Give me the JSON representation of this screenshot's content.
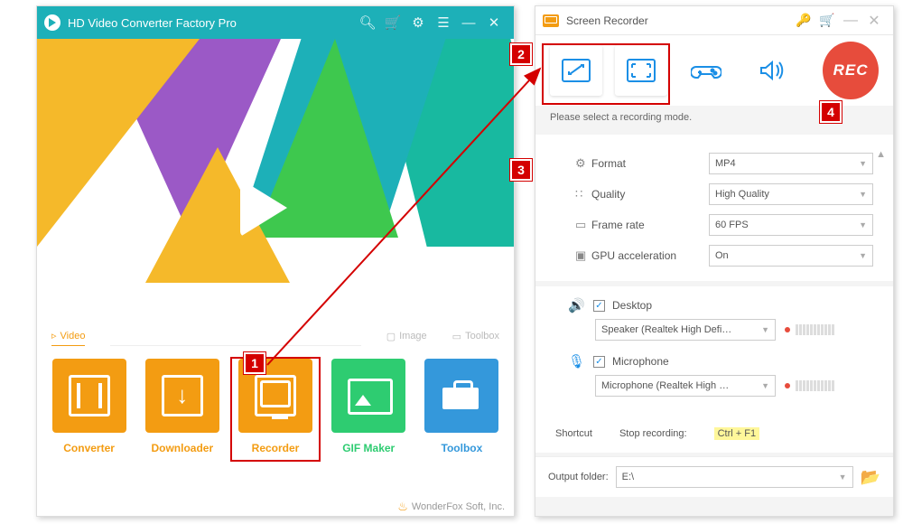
{
  "main": {
    "title": "HD Video Converter Factory Pro",
    "categories": {
      "video": "Video",
      "image": "Image",
      "toolbox": "Toolbox"
    },
    "tiles": {
      "converter": "Converter",
      "downloader": "Downloader",
      "recorder": "Recorder",
      "gif": "GIF Maker",
      "toolbox": "Toolbox"
    },
    "footer": "WonderFox Soft, Inc."
  },
  "recorder": {
    "title": "Screen Recorder",
    "rec_label": "REC",
    "status": "Please select a recording mode.",
    "settings": {
      "format": {
        "label": "Format",
        "value": "MP4"
      },
      "quality": {
        "label": "Quality",
        "value": "High Quality"
      },
      "framerate": {
        "label": "Frame rate",
        "value": "60 FPS"
      },
      "gpu": {
        "label": "GPU acceleration",
        "value": "On"
      }
    },
    "audio": {
      "desktop": {
        "label": "Desktop",
        "device": "Speaker (Realtek High Defi…"
      },
      "microphone": {
        "label": "Microphone",
        "device": "Microphone (Realtek High …"
      }
    },
    "shortcut": {
      "label": "Shortcut",
      "stop_label": "Stop recording:",
      "key": "Ctrl + F1"
    },
    "output": {
      "label": "Output folder:",
      "value": "E:\\"
    }
  },
  "callouts": {
    "c1": "1",
    "c2": "2",
    "c3": "3",
    "c4": "4"
  }
}
